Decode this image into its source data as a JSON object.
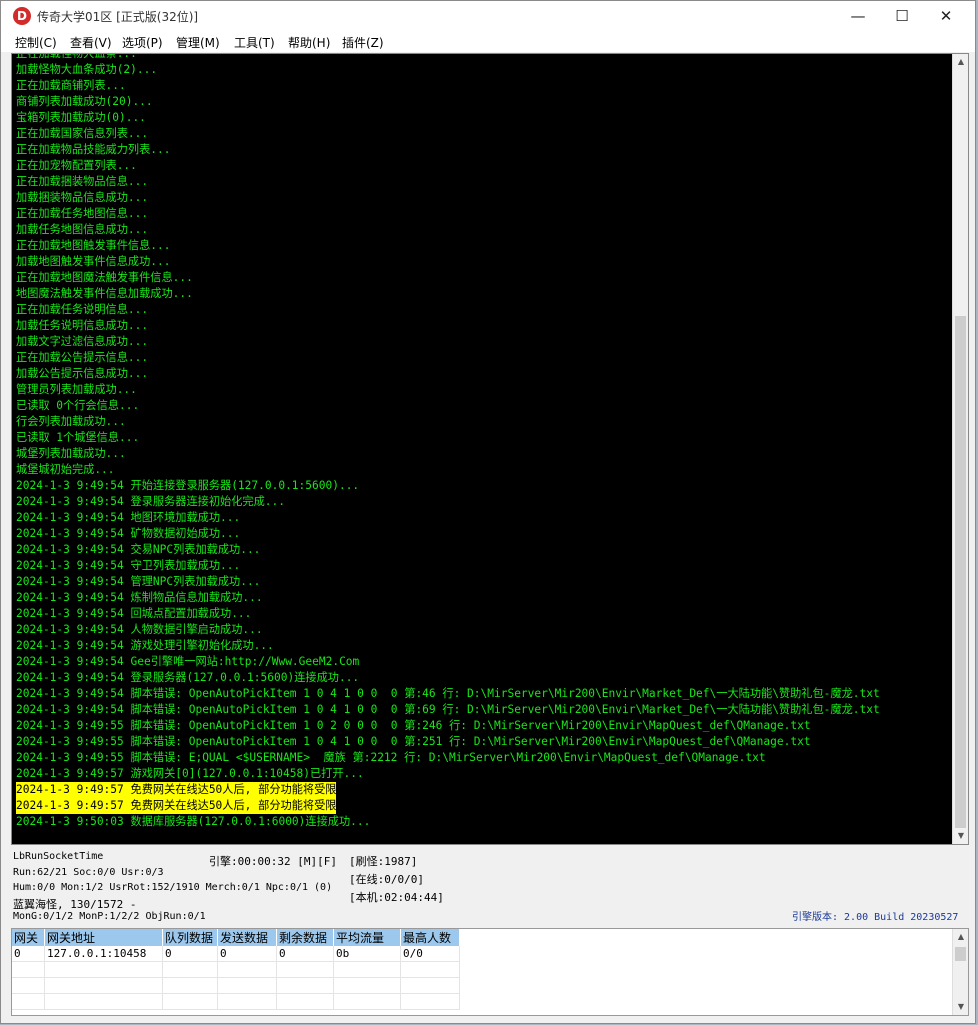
{
  "window": {
    "title": "传奇大学01区 [正式版(32位)]",
    "app_icon": "D",
    "minimize_icon": "minimize-icon",
    "maximize_icon": "maximize-icon",
    "close_icon": "close-icon"
  },
  "menu": [
    "控制(C)",
    "查看(V)",
    "选项(P)",
    "管理(M)",
    "工具(T)",
    "帮助(H)",
    "插件(Z)"
  ],
  "console": {
    "lines": [
      "正在加载怪物大血条...",
      "加载怪物大血条成功(2)...",
      "正在加载商铺列表...",
      "商铺列表加载成功(20)...",
      "宝箱列表加载成功(0)...",
      "正在加载国家信息列表...",
      "正在加载物品技能威力列表...",
      "正在加宠物配置列表...",
      "正在加载捆装物品信息...",
      "加载捆装物品信息成功...",
      "正在加载任务地图信息...",
      "加载任务地图信息成功...",
      "正在加载地图触发事件信息...",
      "加载地图触发事件信息成功...",
      "正在加载地图魔法触发事件信息...",
      "地图魔法触发事件信息加载成功...",
      "正在加载任务说明信息...",
      "加载任务说明信息成功...",
      "加载文字过滤信息成功...",
      "正在加载公告提示信息...",
      "加载公告提示信息成功...",
      "管理员列表加载成功...",
      "已读取 0个行会信息...",
      "行会列表加载成功...",
      "已读取 1个城堡信息...",
      "城堡列表加载成功...",
      "城堡城初始完成...",
      "2024-1-3 9:49:54 开始连接登录服务器(127.0.0.1:5600)...",
      "2024-1-3 9:49:54 登录服务器连接初始化完成...",
      "2024-1-3 9:49:54 地图环境加载成功...",
      "2024-1-3 9:49:54 矿物数据初始成功...",
      "2024-1-3 9:49:54 交易NPC列表加载成功...",
      "2024-1-3 9:49:54 守卫列表加载成功...",
      "2024-1-3 9:49:54 管理NPC列表加载成功...",
      "2024-1-3 9:49:54 炼制物品信息加载成功...",
      "2024-1-3 9:49:54 回城点配置加载成功...",
      "2024-1-3 9:49:54 人物数据引擎启动成功...",
      "2024-1-3 9:49:54 游戏处理引擎初始化成功...",
      "2024-1-3 9:49:54 Gee引擎唯一网站:http://Www.GeeM2.Com",
      "2024-1-3 9:49:54 登录服务器(127.0.0.1:5600)连接成功...",
      "2024-1-3 9:49:54 脚本错误: OpenAutoPickItem 1 0 4 1 0 0  0 第:46 行: D:\\MirServer\\Mir200\\Envir\\Market_Def\\一大陆功能\\赞助礼包-魔龙.txt",
      "2024-1-3 9:49:54 脚本错误: OpenAutoPickItem 1 0 4 1 0 0  0 第:69 行: D:\\MirServer\\Mir200\\Envir\\Market_Def\\一大陆功能\\赞助礼包-魔龙.txt",
      "2024-1-3 9:49:55 脚本错误: OpenAutoPickItem 1 0 2 0 0 0  0 第:246 行: D:\\MirServer\\Mir200\\Envir\\MapQuest_def\\QManage.txt",
      "2024-1-3 9:49:55 脚本错误: OpenAutoPickItem 1 0 4 1 0 0  0 第:251 行: D:\\MirServer\\Mir200\\Envir\\MapQuest_def\\QManage.txt",
      "2024-1-3 9:49:55 脚本错误: E;QUAL <$USERNAME>  魔族 第:2212 行: D:\\MirServer\\Mir200\\Envir\\MapQuest_def\\QManage.txt",
      "2024-1-3 9:49:57 游戏网关[0](127.0.0.1:10458)已打开...",
      "2024-1-3 9:49:57 免费网关在线达50人后, 部分功能将受限",
      "2024-1-3 9:49:57 免费网关在线达50人后, 部分功能将受限",
      "2024-1-3 9:50:03 数据库服务器(127.0.0.1:6000)连接成功..."
    ],
    "highlight_indices": [
      46,
      47
    ],
    "text_color": "#19e619",
    "highlight_color": "#ffff00"
  },
  "status": {
    "socket": "LbRunSocketTime",
    "engine_time": "引擎:00:00:32 [M][F]",
    "refresh_monster": "[刷怪:1987]",
    "run": "Run:62/21 Soc:0/0 Usr:0/3",
    "online": "[在线:0/0/0]",
    "hum": "Hum:0/0 Mon:1/2 UsrRot:152/1910 Merch:0/1 Npc:0/1 (0)",
    "local": "[本机:02:04:44]",
    "monster": "蓝翼海怪, 130/1572 -",
    "mong": "MonG:0/1/2 MonP:1/2/2 ObjRun:0/1",
    "engine_version": "引擎版本: 2.00 Build 20230527"
  },
  "gateway_table": {
    "headers": [
      "网关",
      "网关地址",
      "队列数据",
      "发送数据",
      "剩余数据",
      "平均流量",
      "最高人数"
    ],
    "rows": [
      [
        "0",
        "127.0.0.1:10458",
        "0",
        "0",
        "0",
        "0b",
        "0/0"
      ]
    ]
  }
}
